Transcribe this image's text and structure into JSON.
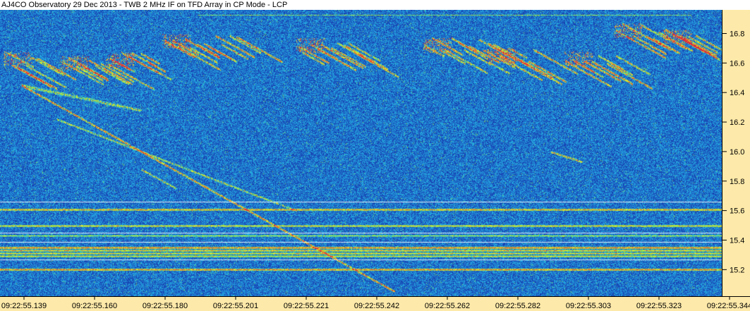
{
  "window": {
    "title": "AJ4CO Observatory 29 Dec 2013 - TWB 2 MHz IF on TFD Array in CP Mode - LCP"
  },
  "chart_data": {
    "type": "heatmap",
    "title": "AJ4CO Observatory 29 Dec 2013 - TWB 2 MHz IF on TFD Array in CP Mode - LCP",
    "xlabel": "",
    "ylabel": "",
    "x_ticks": [
      "09:22:55.139",
      "09:22:55.160",
      "09:22:55.180",
      "09:22:55.201",
      "09:22:55.221",
      "09:22:55.242",
      "09:22:55.262",
      "09:22:55.282",
      "09:22:55.303",
      "09:22:55.323",
      "09:22:55.344"
    ],
    "y_ticks": [
      16.8,
      16.6,
      16.4,
      16.2,
      16.0,
      15.8,
      15.6,
      15.4,
      15.2
    ],
    "y_axis_side": "right",
    "ylim": [
      15.02,
      16.96
    ],
    "colormap": [
      "#0a1a8c",
      "#1a48b8",
      "#25b4e6",
      "#8ae04a",
      "#f0f02a",
      "#f08a2a",
      "#e02a3a"
    ],
    "background_color": "#1c3ba0",
    "axis_panel_color": "#fde9a9",
    "features": {
      "interference_bands_mhz": [
        15.61,
        15.5,
        15.43,
        15.35,
        15.33,
        15.31,
        15.29,
        15.2
      ],
      "s_burst_bands": "sloped bursts between 16.35 and 16.9 MHz across the full time range",
      "drifting_streak": "long negative-drift streak from 16.45 MHz at 09:22:55.139 to about 15.05 MHz at 09:22:55.252"
    }
  }
}
